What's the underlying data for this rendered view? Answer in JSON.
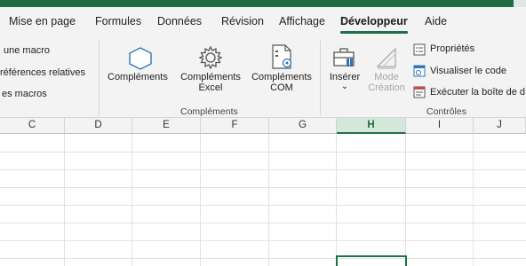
{
  "tabs": [
    {
      "label": "Mise en page",
      "active": false
    },
    {
      "label": "Formules",
      "active": false
    },
    {
      "label": "Données",
      "active": false
    },
    {
      "label": "Révision",
      "active": false
    },
    {
      "label": "Affichage",
      "active": false
    },
    {
      "label": "Développeur",
      "active": true
    },
    {
      "label": "Aide",
      "active": false
    }
  ],
  "code_group": {
    "items": [
      "une macro",
      "références relatives",
      "es macros"
    ]
  },
  "complements_group": {
    "label": "Compléments",
    "buttons": [
      {
        "label": "Compléments",
        "icon": "hexagon-icon"
      },
      {
        "label": "Compléments Excel",
        "line1": "Compléments",
        "line2": "Excel",
        "icon": "gear-icon"
      },
      {
        "label": "Compléments COM",
        "line1": "Compléments",
        "line2": "COM",
        "icon": "com-addin-icon"
      }
    ]
  },
  "controles_group": {
    "label": "Contrôles",
    "insert_label": "Insérer",
    "insert_arrow": "⌄",
    "mode_line1": "Mode",
    "mode_line2": "Création",
    "side_items": [
      {
        "label": "Propriétés",
        "icon": "properties-icon"
      },
      {
        "label": "Visualiser le code",
        "icon": "view-code-icon"
      },
      {
        "label": "Exécuter la boîte de d",
        "icon": "run-dialog-icon"
      }
    ]
  },
  "columns": [
    "C",
    "D",
    "E",
    "F",
    "G",
    "H",
    "I",
    "J"
  ],
  "selected_column": "H",
  "colors": {
    "accent": "#1e7145",
    "header_strip": "#1f6e43",
    "selected_header_bg": "#d3e8da"
  }
}
